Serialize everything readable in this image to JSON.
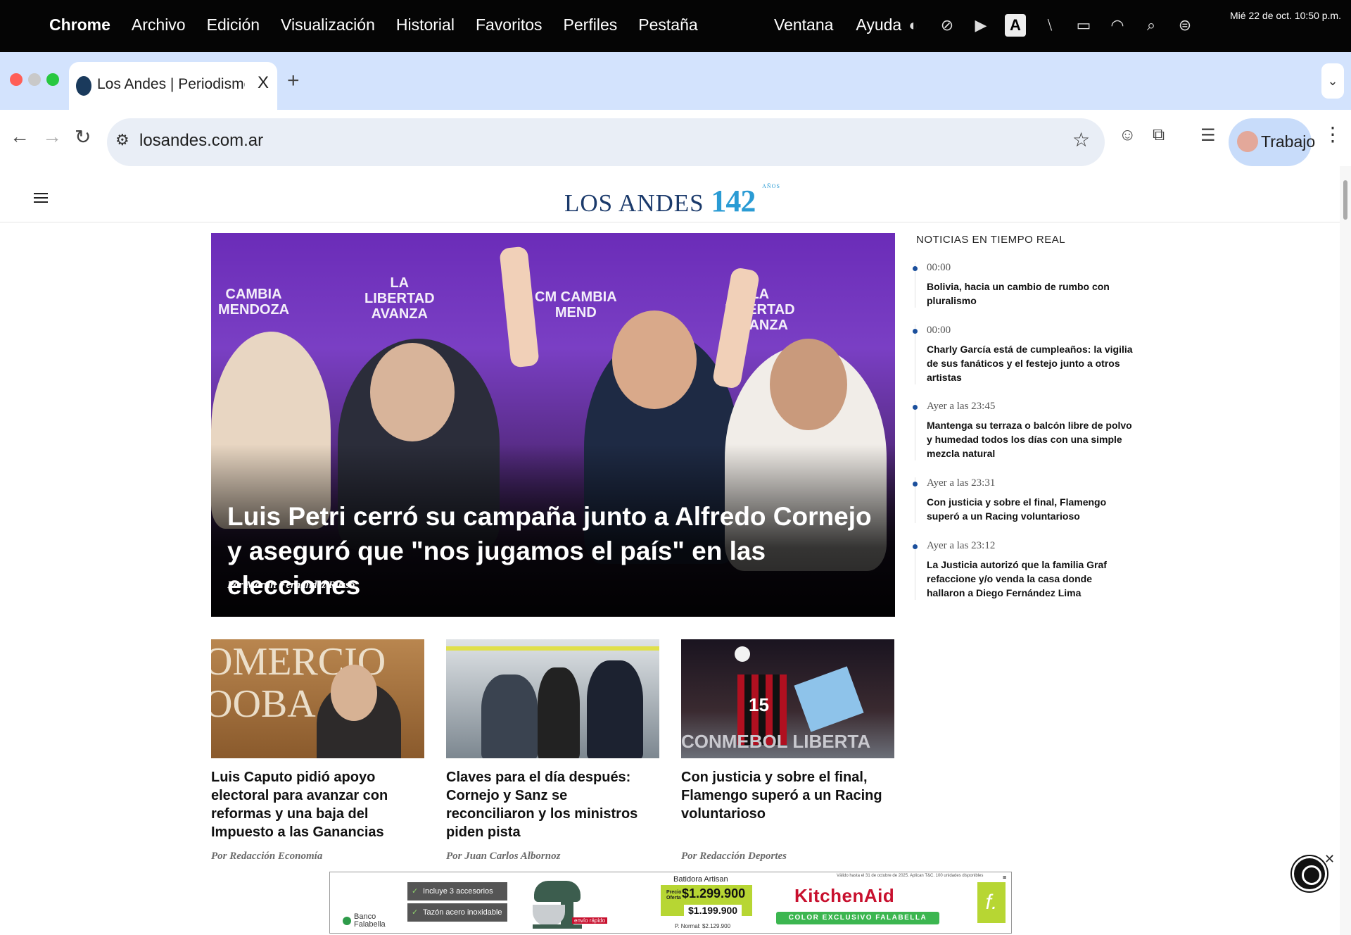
{
  "menubar": {
    "apple_icon": "apple-icon",
    "items": [
      "Chrome",
      "Archivo",
      "Edición",
      "Visualización",
      "Historial",
      "Favoritos",
      "Perfiles",
      "Pestaña"
    ],
    "right_items": [
      "Ventana",
      "Ayuda"
    ],
    "status_icons": [
      "globe-icon",
      "vpn-icon",
      "play-icon",
      "keyboard-a-icon",
      "slash-icon",
      "battery-icon",
      "wifi-icon",
      "spotlight-icon",
      "control-center-icon"
    ],
    "input_badge": "A",
    "clock": "Mié 22 de oct.  10:50 p.m."
  },
  "tabs": {
    "active": {
      "title": "Los Andes | Periodismo de verdad",
      "close": "X"
    },
    "new_tab": "+",
    "dropdown": "⌄"
  },
  "toolbar": {
    "url": "losandes.com.ar",
    "profile_label": "Trabajo"
  },
  "site": {
    "logo_text": "LOS ANDES",
    "logo_number": "142",
    "logo_anos": "AÑOS"
  },
  "hero": {
    "headline": "Luis Petri cerró su campaña junto a Alfredo Cornejo y aseguró que \"nos jugamos el país\" en las elecciones",
    "byline": "Por Martín Fernández Russo",
    "banners": [
      "CAMBIA\nMENDOZA",
      "LA\nLIBERTAD\nAVANZA",
      "CM CAMBIA\nMEND",
      "LA\nLIBERTAD\nAVANZA"
    ]
  },
  "sidebar": {
    "title": "NOTICIAS EN TIEMPO REAL",
    "items": [
      {
        "time": "00:00",
        "title": "Bolivia, hacia un cambio de rumbo con pluralismo"
      },
      {
        "time": "00:00",
        "title": "Charly García está de cumpleaños: la vigilia de sus fanáticos y el festejo junto a otros artistas"
      },
      {
        "time": "Ayer a las 23:45",
        "title": "Mantenga su terraza o balcón libre de polvo y humedad todos los días con una simple mezcla natural"
      },
      {
        "time": "Ayer a las 23:31",
        "title": "Con justicia y sobre el final, Flamengo superó a un Racing voluntarioso"
      },
      {
        "time": "Ayer a las 23:12",
        "title": "La Justicia autorizó que la familia Graf refaccione y/o venda la casa donde hallaron a Diego Fernández Lima"
      }
    ]
  },
  "cards": [
    {
      "title": "Luis Caputo pidió apoyo electoral para avanzar con reformas y una baja del Impuesto a las Ganancias",
      "byline": "Por Redacción Economía",
      "img_text": "OMERCIO\nOOBA"
    },
    {
      "title": "Claves para el día después: Cornejo y Sanz se reconciliaron y los ministros piden pista",
      "byline": "Por Juan Carlos Albornoz"
    },
    {
      "title": "Con justicia y sobre el final, Flamengo superó a un Racing voluntarioso",
      "byline": "Por Redacción Deportes",
      "img_text": "CONMEBOL LIBERTA",
      "jersey": "15"
    }
  ],
  "ad": {
    "fineprint": "Válido hasta el 31 de octubre de 2025. Aplican T&C. 100 unidades disponibles",
    "bank": "Banco\nFalabella",
    "bullets": [
      "Incluye 3 accesorios",
      "Tazón acero inoxidable"
    ],
    "product": "Batidora Artisan",
    "offer_label": "Precio\nOferta",
    "price_offer": "$1.299.900",
    "price_card": "$1.199.900",
    "price_normal": "P. Normal: $2.129.900",
    "shipping": "envío rápido",
    "brand": "KitchenAid",
    "exclusive": "COLOR EXCLUSIVO FALABELLA",
    "store_logo": "f.",
    "close": "✕"
  },
  "colors": {
    "menubar_bg": "#050505",
    "tabstrip_bg": "#d3e3fd",
    "omnibox_bg": "#e9eef6",
    "logo_blue": "#1b3a6b",
    "logo_accent": "#2a9bd4",
    "timeline_dot": "#1b4f9c",
    "ad_green": "#b7d633",
    "kitchenaid_red": "#c8102e"
  }
}
